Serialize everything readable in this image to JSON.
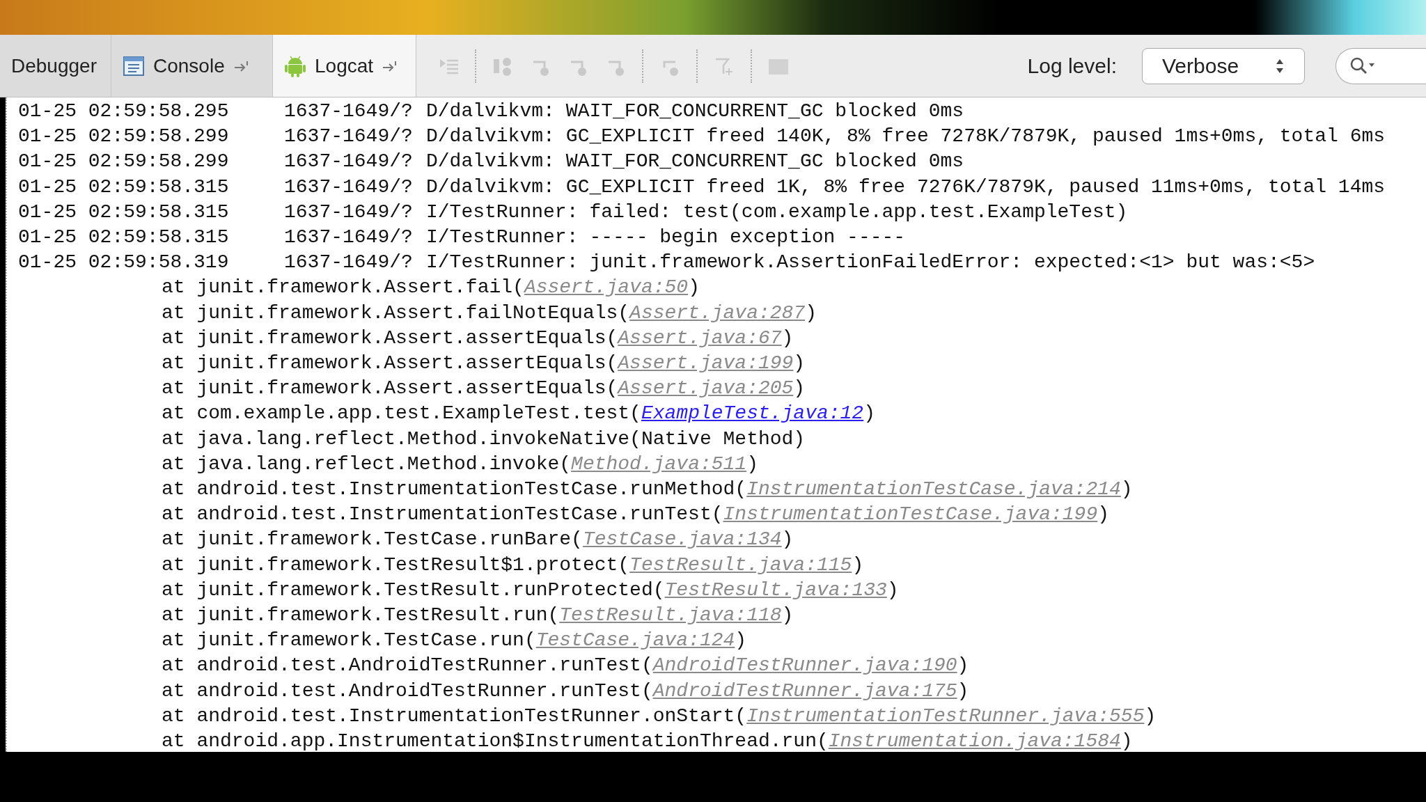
{
  "tabs": [
    {
      "label": "Debugger",
      "selected": false,
      "kind": "plain"
    },
    {
      "label": "Console",
      "selected": false,
      "kind": "console"
    },
    {
      "label": "Logcat",
      "selected": true,
      "kind": "android"
    }
  ],
  "toolbar_buttons": [
    {
      "kind": "list",
      "disabled": true
    },
    {
      "kind": "separator"
    },
    {
      "kind": "split",
      "disabled": true
    },
    {
      "kind": "step",
      "disabled": true
    },
    {
      "kind": "step",
      "disabled": true
    },
    {
      "kind": "step",
      "disabled": true
    },
    {
      "kind": "separator"
    },
    {
      "kind": "return",
      "disabled": true
    },
    {
      "kind": "separator"
    },
    {
      "kind": "filter",
      "disabled": true
    },
    {
      "kind": "separator"
    },
    {
      "kind": "block",
      "disabled": true
    }
  ],
  "log_level": {
    "label": "Log level:",
    "value": "Verbose"
  },
  "entries": [
    {
      "time": "01-25 02:59:58.295",
      "pid": "1637-1649/?",
      "tag": "D/dalvikvm:",
      "message": "WAIT_FOR_CONCURRENT_GC blocked 0ms"
    },
    {
      "time": "01-25 02:59:58.299",
      "pid": "1637-1649/?",
      "tag": "D/dalvikvm:",
      "message": "GC_EXPLICIT freed 140K, 8% free 7278K/7879K, paused 1ms+0ms, total 6ms"
    },
    {
      "time": "01-25 02:59:58.299",
      "pid": "1637-1649/?",
      "tag": "D/dalvikvm:",
      "message": "WAIT_FOR_CONCURRENT_GC blocked 0ms"
    },
    {
      "time": "01-25 02:59:58.315",
      "pid": "1637-1649/?",
      "tag": "D/dalvikvm:",
      "message": "GC_EXPLICIT freed 1K, 8% free 7276K/7879K, paused 11ms+0ms, total 14ms"
    },
    {
      "time": "01-25 02:59:58.315",
      "pid": "1637-1649/?",
      "tag": "I/TestRunner:",
      "message": "failed: test(com.example.app.test.ExampleTest)"
    },
    {
      "time": "01-25 02:59:58.315",
      "pid": "1637-1649/?",
      "tag": "I/TestRunner:",
      "message": "----- begin exception -----"
    },
    {
      "time": "01-25 02:59:58.319",
      "pid": "1637-1649/?",
      "tag": "I/TestRunner:",
      "message": "junit.framework.AssertionFailedError: expected:<1> but was:<5>"
    }
  ],
  "stack": [
    {
      "kind": "library",
      "call": "at junit.framework.Assert.fail(",
      "link": "Assert.java:50",
      "end": ")"
    },
    {
      "kind": "library",
      "call": "at junit.framework.Assert.failNotEquals(",
      "link": "Assert.java:287",
      "end": ")"
    },
    {
      "kind": "library",
      "call": "at junit.framework.Assert.assertEquals(",
      "link": "Assert.java:67",
      "end": ")"
    },
    {
      "kind": "library",
      "call": "at junit.framework.Assert.assertEquals(",
      "link": "Assert.java:199",
      "end": ")"
    },
    {
      "kind": "library",
      "call": "at junit.framework.Assert.assertEquals(",
      "link": "Assert.java:205",
      "end": ")"
    },
    {
      "kind": "project",
      "call": "at com.example.app.test.ExampleTest.test(",
      "link": "ExampleTest.java:12",
      "end": ")"
    },
    {
      "kind": "plain",
      "call": "at java.lang.reflect.Method.invokeNative(Native Method)"
    },
    {
      "kind": "library",
      "call": "at java.lang.reflect.Method.invoke(",
      "link": "Method.java:511",
      "end": ")"
    },
    {
      "kind": "library",
      "call": "at android.test.InstrumentationTestCase.runMethod(",
      "link": "InstrumentationTestCase.java:214",
      "end": ")"
    },
    {
      "kind": "library",
      "call": "at android.test.InstrumentationTestCase.runTest(",
      "link": "InstrumentationTestCase.java:199",
      "end": ")"
    },
    {
      "kind": "library",
      "call": "at junit.framework.TestCase.runBare(",
      "link": "TestCase.java:134",
      "end": ")"
    },
    {
      "kind": "library",
      "call": "at junit.framework.TestResult$1.protect(",
      "link": "TestResult.java:115",
      "end": ")"
    },
    {
      "kind": "library",
      "call": "at junit.framework.TestResult.runProtected(",
      "link": "TestResult.java:133",
      "end": ")"
    },
    {
      "kind": "library",
      "call": "at junit.framework.TestResult.run(",
      "link": "TestResult.java:118",
      "end": ")"
    },
    {
      "kind": "library",
      "call": "at junit.framework.TestCase.run(",
      "link": "TestCase.java:124",
      "end": ")"
    },
    {
      "kind": "library",
      "call": "at android.test.AndroidTestRunner.runTest(",
      "link": "AndroidTestRunner.java:190",
      "end": ")"
    },
    {
      "kind": "library",
      "call": "at android.test.AndroidTestRunner.runTest(",
      "link": "AndroidTestRunner.java:175",
      "end": ")"
    },
    {
      "kind": "library",
      "call": "at android.test.InstrumentationTestRunner.onStart(",
      "link": "InstrumentationTestRunner.java:555",
      "end": ")"
    },
    {
      "kind": "library",
      "call": "at android.app.Instrumentation$InstrumentationThread.run(",
      "link": "Instrumentation.java:1584",
      "end": ")"
    }
  ]
}
